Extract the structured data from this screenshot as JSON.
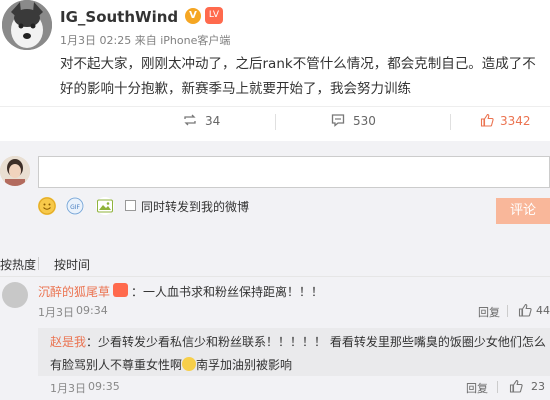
{
  "post": {
    "author": "IG_SouthWind",
    "verified_badge": "V",
    "level_badge": "LV",
    "date": "1月3日",
    "time": "02:25",
    "from_label": "来自",
    "source": "iPhone客户端",
    "content_line1": "对不起大家，刚刚太冲动了，之后rank不管什么情况，都会克制自己。造成了不",
    "content_line2": "好的影响十分抱歉，新赛季马上就要开始了，我会努力训练"
  },
  "actions": {
    "repost_count": "34",
    "comment_count": "530",
    "like_count": "3342",
    "like_color": "#eb7350"
  },
  "composer": {
    "repost_checkbox_label": "同时转发到我的微博",
    "submit_label": "评论",
    "submit_color": "#f9b79a"
  },
  "sort": {
    "tab_hot": "按热度",
    "tab_time": "按时间"
  },
  "comment1": {
    "author": "沉醉的狐尾草",
    "text": "：一人血书求和粉丝保持距离！！！",
    "date": "1月3日",
    "time": "09:34",
    "reply_label": "回复",
    "like_count": "44"
  },
  "reply": {
    "author": "赵是我",
    "text_line1": "：少看转发少看私信少和粉丝联系！！！！！ 看看转发里那些嘴臭的饭圈少女他们怎么",
    "text_line2_a": "有脸骂别人不尊重女性啊",
    "text_line2_b": "南孚加油别被影响",
    "date": "1月3日",
    "time": "09:35",
    "reply_label": "回复",
    "like_count": "23"
  },
  "icons": [
    "repost-icon",
    "comment-icon",
    "like-icon",
    "emoji-icon",
    "gif-icon",
    "image-icon"
  ]
}
